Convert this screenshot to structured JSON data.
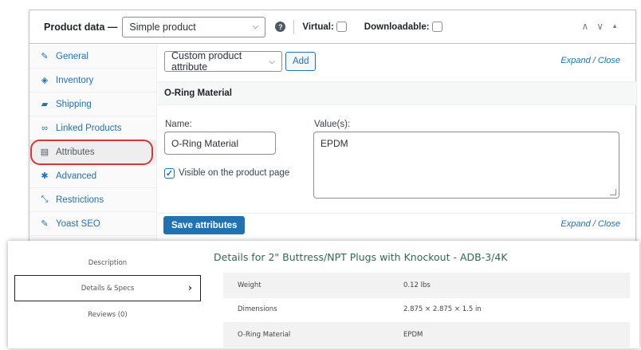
{
  "admin": {
    "header": {
      "title": "Product data —",
      "product_type": "Simple product",
      "help_glyph": "?",
      "virtual_label": "Virtual:",
      "downloadable_label": "Downloadable:",
      "arrows": [
        "∧",
        "∨",
        "▲"
      ]
    },
    "tabs": [
      {
        "label": "General",
        "icon": "wrench-icon",
        "glyph": "✎"
      },
      {
        "label": "Inventory",
        "icon": "tag-icon",
        "glyph": "◈"
      },
      {
        "label": "Shipping",
        "icon": "truck-icon",
        "glyph": "▰"
      },
      {
        "label": "Linked Products",
        "icon": "link-icon",
        "glyph": "∞"
      },
      {
        "label": "Attributes",
        "icon": "list-icon",
        "glyph": "▤"
      },
      {
        "label": "Advanced",
        "icon": "gear-icon",
        "glyph": "✱"
      },
      {
        "label": "Restrictions",
        "icon": "collapse-icon",
        "glyph": "⤡"
      },
      {
        "label": "Yoast SEO",
        "icon": "wrench-icon",
        "glyph": "✎"
      }
    ],
    "active_tab": "Attributes",
    "attributes": {
      "select_value": "Custom product attribute",
      "add_label": "Add",
      "expand": "Expand",
      "slash": "/",
      "close": "Close",
      "attr_title": "O-Ring Material",
      "name_label": "Name:",
      "name_value": "O-Ring Material",
      "values_label": "Value(s):",
      "values_value": "EPDM",
      "visible_label": "Visible on the product page",
      "check_glyph": "✓",
      "save_label": "Save attributes"
    },
    "accent_color": "#2271b1",
    "highlight_color": "#d63638"
  },
  "front": {
    "tabs": [
      "Description",
      "Details & Specs",
      "Reviews (0)"
    ],
    "arrow": "›",
    "title": "Details for 2\" Buttress/NPT Plugs with Knockout - ADB-3/4K",
    "specs": [
      {
        "label": "Weight",
        "value": "0.12 lbs"
      },
      {
        "label": "Dimensions",
        "value": "2.875 × 2.875 × 1.5 in"
      },
      {
        "label": "O-Ring Material",
        "value": "EPDM"
      }
    ],
    "title_color": "#2f6b4f"
  }
}
